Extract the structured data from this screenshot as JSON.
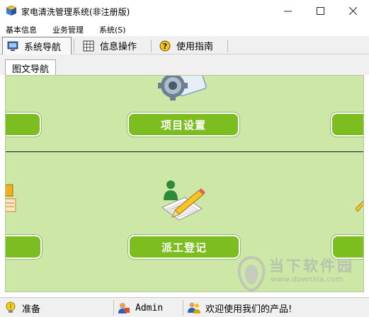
{
  "window": {
    "title": "家电清洗管理系统(非注册版)"
  },
  "menubar": {
    "items": [
      "基本信息",
      "业务管理",
      "系统(S)"
    ]
  },
  "toolbar": {
    "tabs": [
      "系统导航",
      "信息操作",
      "使用指南"
    ]
  },
  "subtabs": {
    "active": "图文导航"
  },
  "nav": {
    "top_left_label": "",
    "top_center_label": "项目设置",
    "top_right_label": "",
    "bottom_left_label": "",
    "bottom_center_label": "派工登记",
    "bottom_right_label": ""
  },
  "watermark": {
    "brand": "当下软件园",
    "url": "www.downxia.com"
  },
  "status": {
    "state": "准备",
    "user": "Admin",
    "message": "欢迎使用我们的产品!"
  },
  "colors": {
    "panel_bg": "#cde8a6",
    "button_green": "#7cbd1f",
    "accent_blue": "#2c6fb0"
  }
}
